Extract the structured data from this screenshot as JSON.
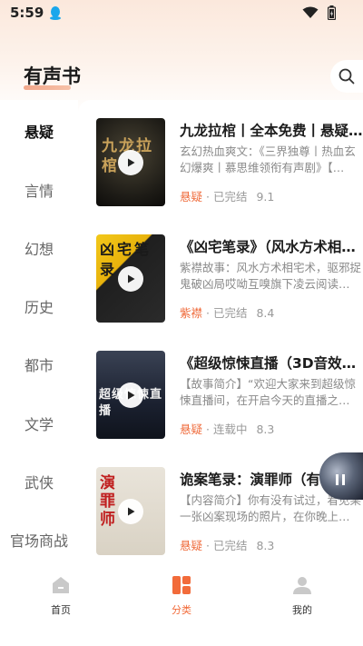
{
  "status_bar": {
    "time": "5:59"
  },
  "header": {
    "title": "有声书"
  },
  "sidebar": {
    "items": [
      {
        "label": "悬疑",
        "active": true
      },
      {
        "label": "言情",
        "active": false
      },
      {
        "label": "幻想",
        "active": false
      },
      {
        "label": "历史",
        "active": false
      },
      {
        "label": "都市",
        "active": false
      },
      {
        "label": "文学",
        "active": false
      },
      {
        "label": "武侠",
        "active": false
      },
      {
        "label": "官场商战",
        "active": false
      }
    ]
  },
  "books": [
    {
      "title": "九龙拉棺丨全本免费丨悬疑…",
      "desc": "玄幻热血爽文：《三界独尊丨热血玄幻爆爽丨慕思维领衔有声剧》【…",
      "tag": "悬疑",
      "status": "已完结",
      "score": "9.1",
      "cover_text": "九龙拉棺"
    },
    {
      "title": "《凶宅笔录》（风水方术相…",
      "desc": "紫襟故事：风水方术相宅术，驱邪捉鬼破凶局哎呦互嗅旗下凌云阅读…",
      "tag": "紫襟",
      "status": "已完结",
      "score": "8.4",
      "cover_text": "凶宅笔录"
    },
    {
      "title": "《超级惊悚直播（3D音效…",
      "desc": "【故事简介】“欢迎大家来到超级惊悚直播间，在开启今天的直播之…",
      "tag": "悬疑",
      "status": "连载中",
      "score": "8.3",
      "cover_text": "超级惊悚直播"
    },
    {
      "title": "诡案笔录：演罪师（有…",
      "desc": "【内容简介】你有没有试过，看见某一张凶案现场的照片，在你晚上…",
      "tag": "悬疑",
      "status": "已完结",
      "score": "8.3",
      "cover_text": "演罪师"
    }
  ],
  "tabbar": {
    "items": [
      {
        "label": "首页",
        "active": false
      },
      {
        "label": "分类",
        "active": true
      },
      {
        "label": "我的",
        "active": false
      }
    ]
  },
  "colors": {
    "accent": "#f26b3a",
    "tag": "#ef6a3a"
  },
  "separator": "·"
}
